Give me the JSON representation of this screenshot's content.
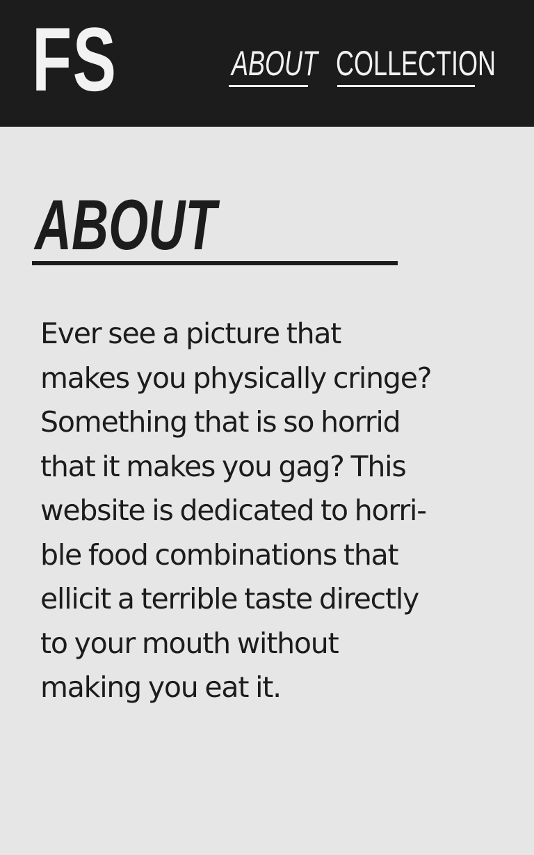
{
  "header": {
    "logo": "FS",
    "nav": {
      "about_label": "ABOUT",
      "collection_label": "COLLECTION"
    }
  },
  "main": {
    "title": "ABOUT",
    "body": "Ever see a picture that\nmakes you physically cringe?\nSomething that is so horrid\nthat it makes you gag? This\nwebsite is dedicated to horri-\nble food combinations that\nellicit a terrible taste directly\nto your mouth without\nmaking you eat it."
  },
  "colors": {
    "header_bg": "#1c1c1c",
    "page_bg": "#e6e6e6",
    "text_dark": "#1c1c1c",
    "text_light": "#f2f2f2"
  }
}
